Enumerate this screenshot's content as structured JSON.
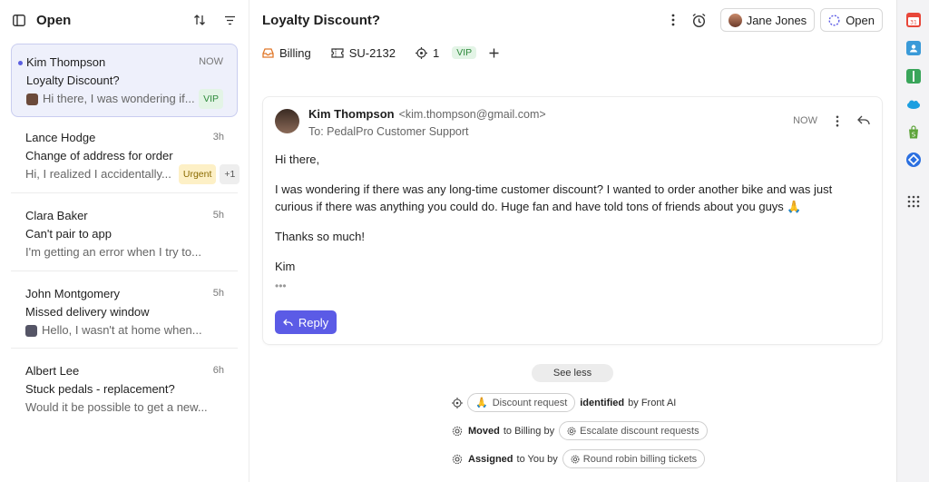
{
  "left": {
    "title": "Open",
    "conversations": [
      {
        "name": "Kim Thompson",
        "time": "NOW",
        "subject": "Loyalty Discount?",
        "preview": "Hi there, I was wondering if...",
        "tag": "VIP"
      },
      {
        "name": "Lance Hodge",
        "time": "3h",
        "subject": "Change of address for order",
        "preview": "Hi, I realized I accidentally...",
        "tag": "Urgent",
        "count": "+1"
      },
      {
        "name": "Clara Baker",
        "time": "5h",
        "subject": "Can't pair to app",
        "preview": "I'm getting an error when I try to..."
      },
      {
        "name": "John Montgomery",
        "time": "5h",
        "subject": "Missed delivery window",
        "preview": "Hello, I wasn't at home when..."
      },
      {
        "name": "Albert Lee",
        "time": "6h",
        "subject": "Stuck pedals - replacement?",
        "preview": "Would it be possible to get a new..."
      }
    ]
  },
  "main": {
    "title": "Loyalty Discount?",
    "assignee": "Jane Jones",
    "status": "Open",
    "tags": {
      "inbox": "Billing",
      "ticket": "SU-2132",
      "count": "1",
      "vip": "VIP"
    },
    "email": {
      "from": "Kim Thompson",
      "address": "<kim.thompson@gmail.com>",
      "to": "To: PedalPro Customer Support",
      "time": "NOW",
      "greeting": "Hi there,",
      "body": "I was wondering if there was any long-time customer discount? I wanted to order another bike and was just curious if there was anything you could do. Huge fan and have told tons of friends about you guys 🙏",
      "thanks": "Thanks so much!",
      "sign": "Kim",
      "reply_label": "Reply"
    },
    "see_less": "See less",
    "activity": [
      {
        "pill": "Discount request",
        "text": "identified",
        "suffix": "by Front AI"
      },
      {
        "prefix_bold": "Moved",
        "prefix": "to Billing by",
        "pill": "Escalate discount requests"
      },
      {
        "prefix_bold": "Assigned",
        "prefix": "to You by",
        "pill": "Round robin billing tickets"
      }
    ]
  },
  "colors": {
    "accent": "#5b5be6",
    "vip": "#2f8a3c",
    "urgent": "#8a6a00"
  }
}
